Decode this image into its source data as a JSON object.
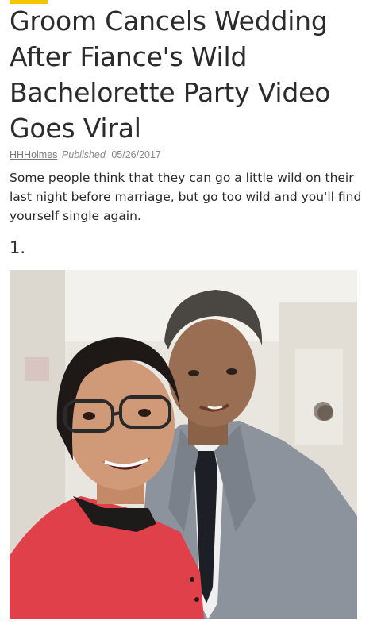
{
  "article": {
    "title": "Groom Cancels Wedding After Fiance's Wild Bachelorette Party Video Goes Viral",
    "author": "HHHolmes",
    "published_label": "Published",
    "date": "05/26/2017",
    "intro": "Some people think that they can go a little wild on their last night before marriage, but go too wild and you'll find yourself single again.",
    "item_number": "1.",
    "accent_color": "#f2c500"
  }
}
